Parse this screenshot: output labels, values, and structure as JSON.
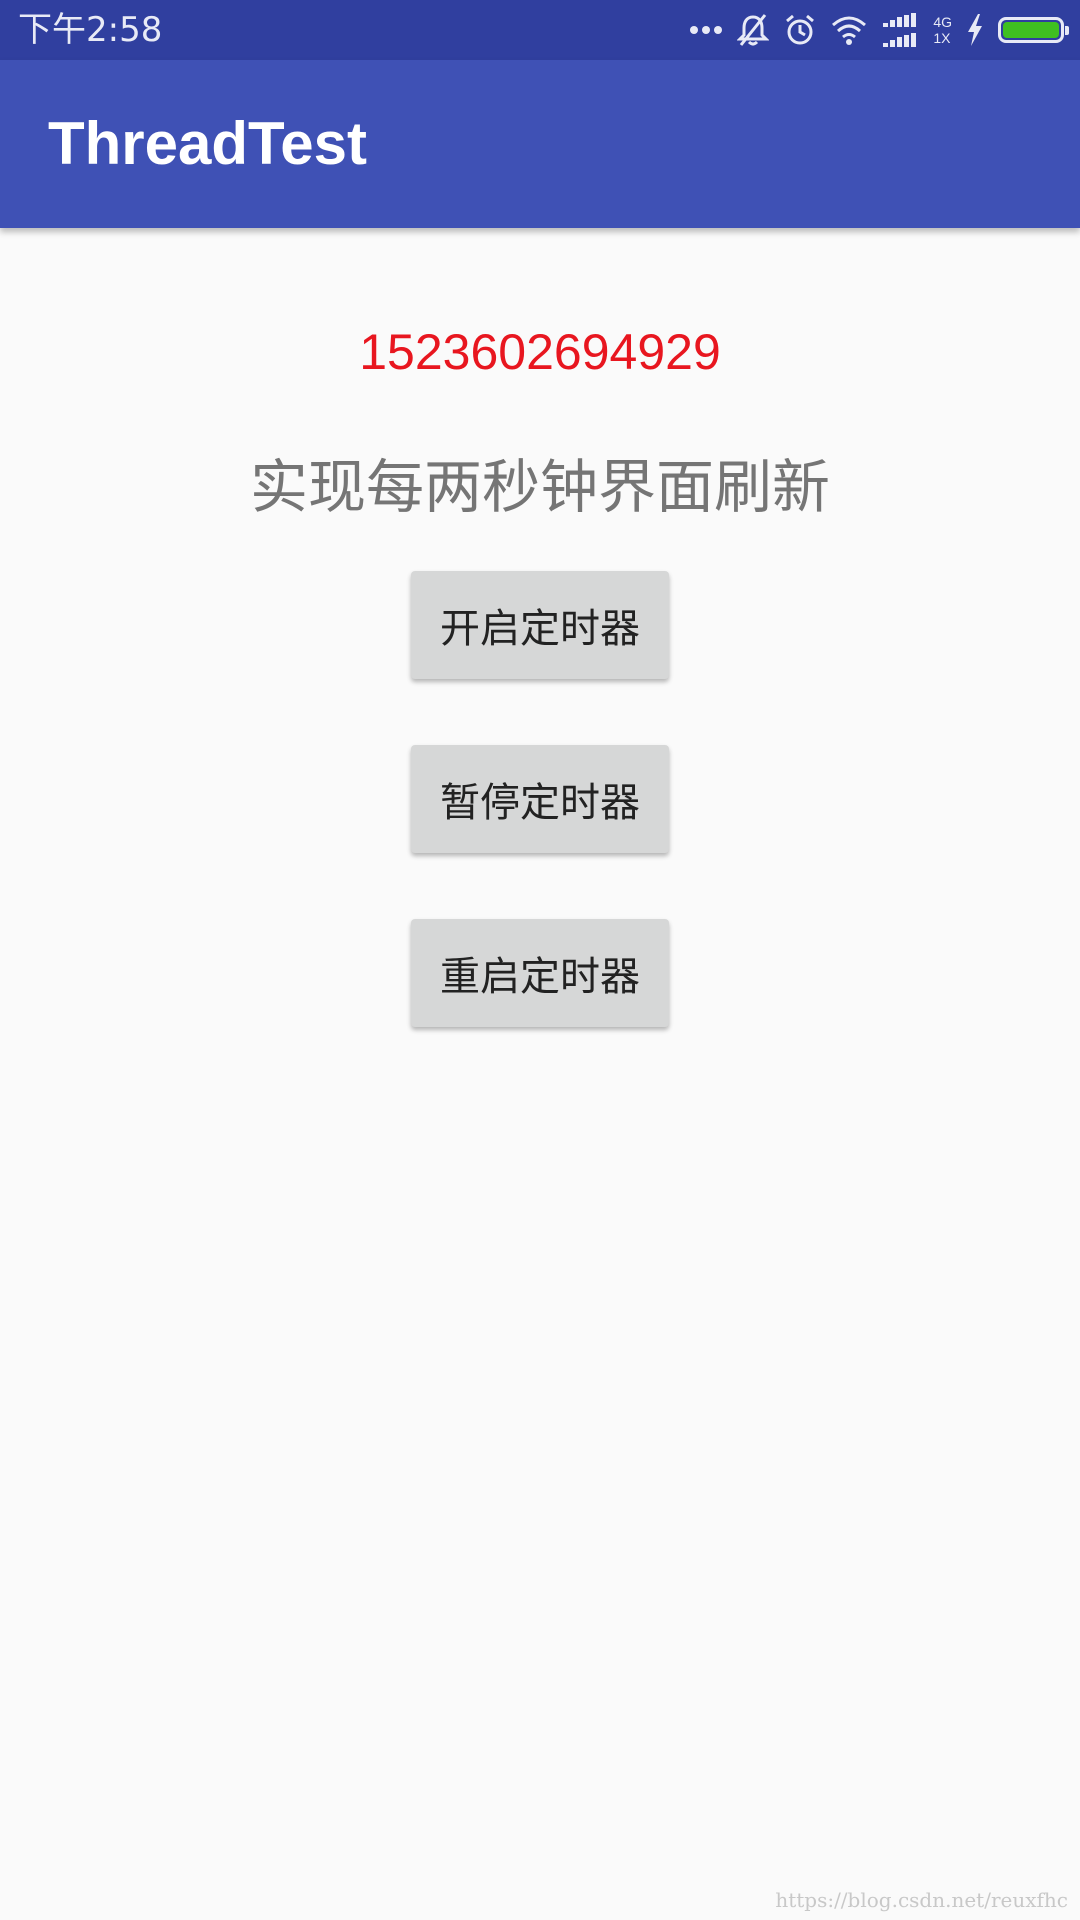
{
  "status_bar": {
    "time": "下午2:58",
    "network_top": "4G",
    "network_bottom": "1X",
    "battery_level": 1.0,
    "battery_color": "#3fc021",
    "icons": [
      "more-dots-icon",
      "bell-off-icon",
      "alarm-icon",
      "wifi-icon",
      "signal-icon",
      "signal-icon",
      "charging-icon",
      "battery-icon"
    ]
  },
  "app_bar": {
    "title": "ThreadTest",
    "color": "#3f51b5"
  },
  "main": {
    "timestamp": "1523602694929",
    "timestamp_color": "#e8161f",
    "caption": "实现每两秒钟界面刷新",
    "buttons": {
      "start": "开启定时器",
      "pause": "暂停定时器",
      "restart": "重启定时器"
    }
  },
  "watermark": "https://blog.csdn.net/reuxfhc"
}
